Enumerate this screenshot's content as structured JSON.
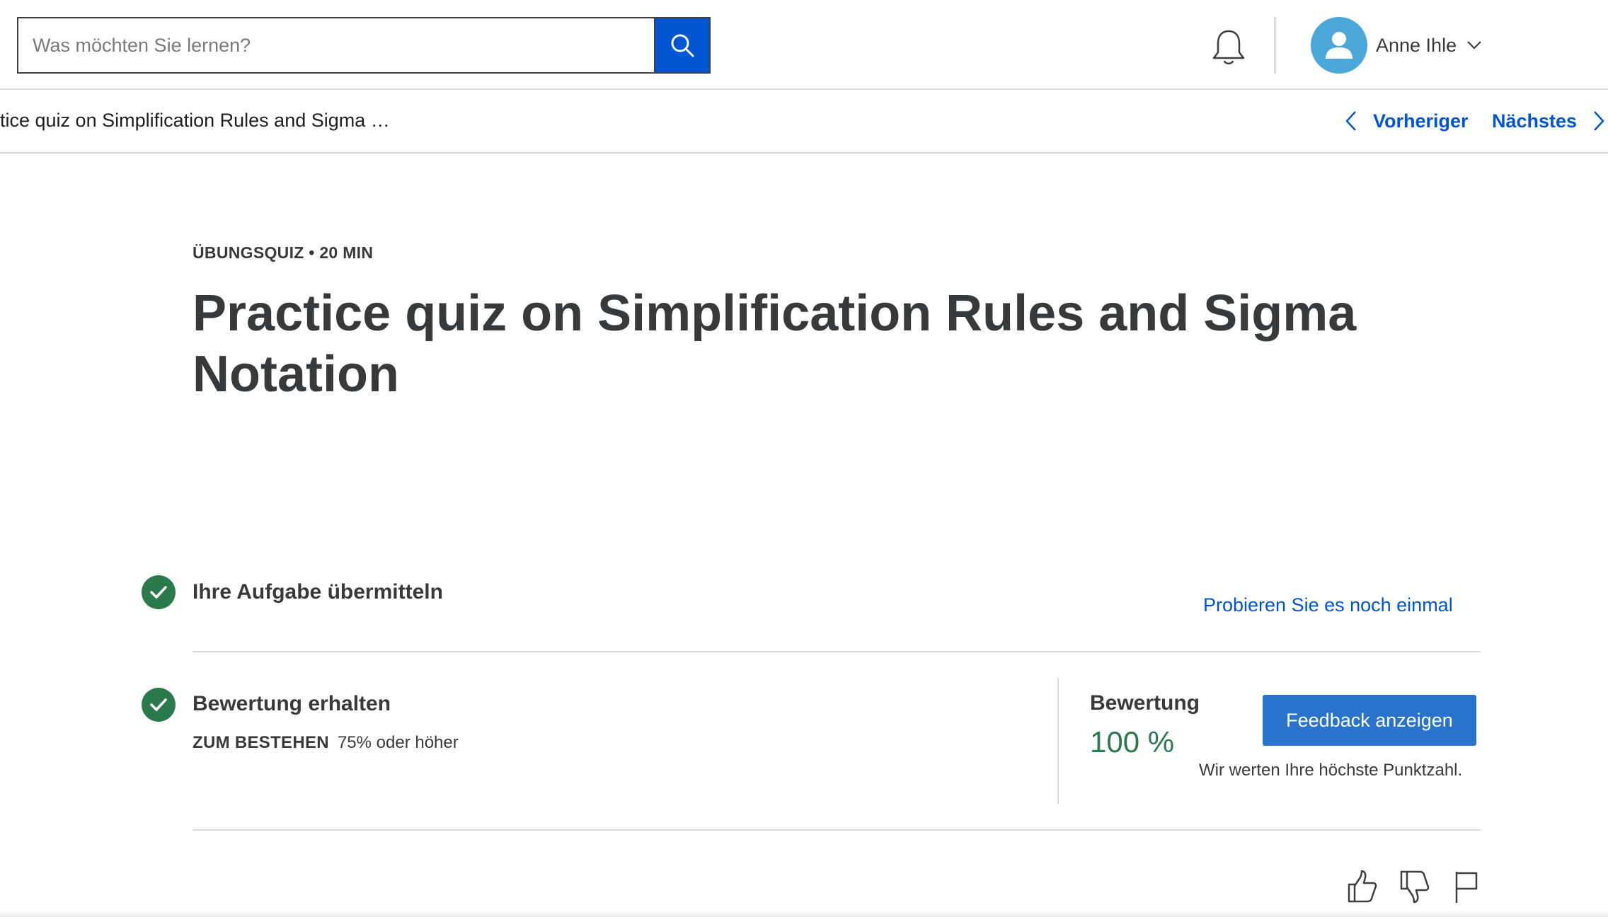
{
  "header": {
    "search": {
      "placeholder": "Was möchten Sie lernen?",
      "value": ""
    },
    "user": {
      "name": "Anne Ihle"
    }
  },
  "subnav": {
    "breadcrumb": "tice quiz on Simplification Rules and Sigma …",
    "prev_label": "Vorheriger",
    "next_label": "Nächstes"
  },
  "main": {
    "eyebrow": "ÜBUNGSQUIZ • 20 MIN",
    "title": "Practice quiz on Simplification Rules and Sigma Notation",
    "submit_section": {
      "heading": "Ihre Aufgabe übermitteln",
      "retry_label": "Probieren Sie es noch einmal"
    },
    "grade_section": {
      "heading": "Bewertung erhalten",
      "pass_label": "ZUM BESTEHEN",
      "pass_value": "75% oder höher",
      "grade_label": "Bewertung",
      "grade_value": "100 %",
      "feedback_button": "Feedback anzeigen",
      "note": "Wir werten Ihre höchste Punktzahl."
    }
  },
  "colors": {
    "accent": "#0056d2",
    "success": "#2b7a4b",
    "button": "#2a73cc",
    "avatar": "#4aa7d8"
  },
  "icons": [
    "search-icon",
    "bell-icon",
    "user-icon",
    "chevron-down-icon",
    "chevron-left-icon",
    "chevron-right-icon",
    "check-icon",
    "thumbs-up-icon",
    "thumbs-down-icon",
    "flag-icon"
  ]
}
